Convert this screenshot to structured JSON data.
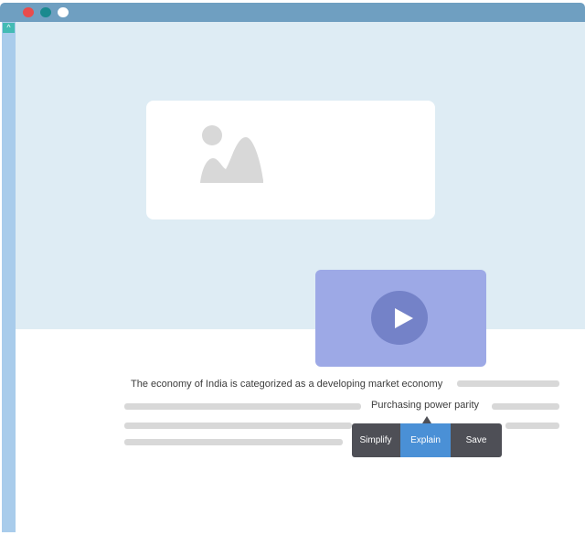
{
  "window": {
    "controls": [
      "close",
      "minimize",
      "maximize"
    ],
    "colors": {
      "titlebar": "#6f9fc1",
      "close": "#e84c4c",
      "minimize": "#1b8a8f",
      "maximize": "#ffffff"
    }
  },
  "sidebar": {
    "scroll_up_icon": "chevron-up-icon",
    "scroll_up_glyph": "^"
  },
  "hero": {
    "image_icon": "image-placeholder-icon",
    "video_icon": "play-icon",
    "colors": {
      "background": "#deecf4",
      "video_card": "#9da9e6",
      "play_button": "#7482c8"
    }
  },
  "article": {
    "sentence": "The economy of India is categorized as a developing market economy",
    "highlighted_phrase": "Purchasing power parity"
  },
  "selection_toolbar": {
    "buttons": [
      {
        "label": "Simplify",
        "selected": false
      },
      {
        "label": "Explain",
        "selected": true
      },
      {
        "label": "Save",
        "selected": false
      }
    ],
    "colors": {
      "background": "#4e4f56",
      "selected": "#4a90d6"
    }
  }
}
